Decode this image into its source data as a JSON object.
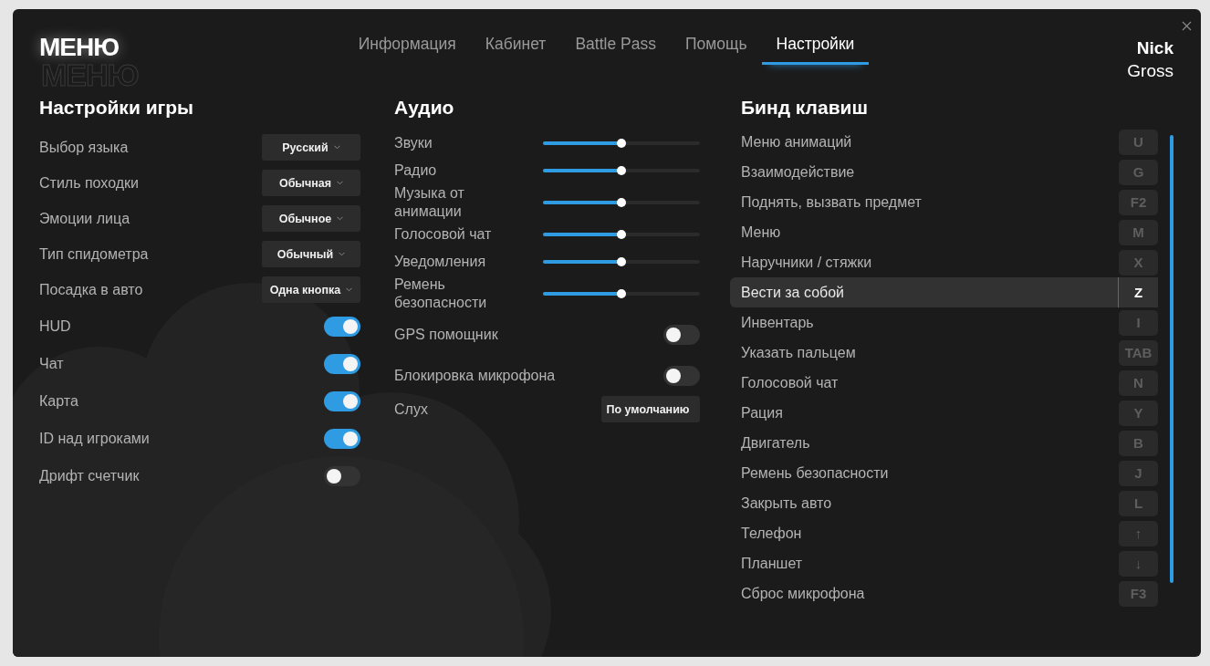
{
  "logo": {
    "title": "МЕНЮ",
    "echo": "МЕНЮ"
  },
  "tabs": [
    {
      "label": "Информация",
      "selected": false
    },
    {
      "label": "Кабинет",
      "selected": false
    },
    {
      "label": "Battle Pass",
      "selected": false
    },
    {
      "label": "Помощь",
      "selected": false
    },
    {
      "label": "Настройки",
      "selected": true
    }
  ],
  "user": {
    "first_name": "Nick",
    "last_name": "Gross"
  },
  "game_settings": {
    "title": "Настройки игры",
    "items": [
      {
        "kind": "select",
        "label": "Выбор языка",
        "value": "Русский"
      },
      {
        "kind": "select",
        "label": "Стиль походки",
        "value": "Обычная"
      },
      {
        "kind": "select",
        "label": "Эмоции лица",
        "value": "Обычное"
      },
      {
        "kind": "select",
        "label": "Тип спидометра",
        "value": "Обычный"
      },
      {
        "kind": "select",
        "label": "Посадка в авто",
        "value": "Одна кнопка"
      },
      {
        "kind": "toggle",
        "label": "HUD",
        "on": true
      },
      {
        "kind": "toggle",
        "label": "Чат",
        "on": true
      },
      {
        "kind": "toggle",
        "label": "Карта",
        "on": true
      },
      {
        "kind": "toggle",
        "label": "ID над игроками",
        "on": true
      },
      {
        "kind": "toggle",
        "label": "Дрифт счетчик",
        "on": false
      }
    ]
  },
  "audio": {
    "title": "Аудио",
    "items": [
      {
        "kind": "slider",
        "label": "Звуки",
        "level": 0.5
      },
      {
        "kind": "slider",
        "label": "Радио",
        "level": 0.5
      },
      {
        "kind": "slider",
        "label": "Музыка от анимации",
        "level": 0.5
      },
      {
        "kind": "slider",
        "label": "Голосовой чат",
        "level": 0.5
      },
      {
        "kind": "slider",
        "label": "Уведомления",
        "level": 0.5
      },
      {
        "kind": "slider",
        "label": "Ремень безопасности",
        "level": 0.5
      },
      {
        "kind": "toggle",
        "label": "GPS помощник",
        "on": false
      },
      {
        "kind": "toggle",
        "label": "Блокировка микрофона",
        "on": false
      },
      {
        "kind": "select",
        "label": "Слух",
        "value": "По умолчанию"
      }
    ]
  },
  "keybinds": {
    "title": "Бинд клавиш",
    "items": [
      {
        "action": "Меню анимаций",
        "key": "U",
        "selected": false
      },
      {
        "action": "Взаимодействие",
        "key": "G",
        "selected": false
      },
      {
        "action": "Поднять, вызвать предмет",
        "key": "F2",
        "selected": false
      },
      {
        "action": "Меню",
        "key": "M",
        "selected": false
      },
      {
        "action": "Наручники / стяжки",
        "key": "X",
        "selected": false
      },
      {
        "action": "Вести за собой",
        "key": "Z",
        "selected": true
      },
      {
        "action": "Инвентарь",
        "key": "I",
        "selected": false
      },
      {
        "action": "Указать пальцем",
        "key": "TAB",
        "selected": false
      },
      {
        "action": "Голосовой чат",
        "key": "N",
        "selected": false
      },
      {
        "action": "Рация",
        "key": "Y",
        "selected": false
      },
      {
        "action": "Двигатель",
        "key": "B",
        "selected": false
      },
      {
        "action": "Ремень безопасности",
        "key": "J",
        "selected": false
      },
      {
        "action": "Закрыть авто",
        "key": "L",
        "selected": false
      },
      {
        "action": "Телефон",
        "key": "↑",
        "selected": false
      },
      {
        "action": "Планшет",
        "key": "↓",
        "selected": false
      },
      {
        "action": "Сброс микрофона",
        "key": "F3",
        "selected": false
      }
    ]
  }
}
